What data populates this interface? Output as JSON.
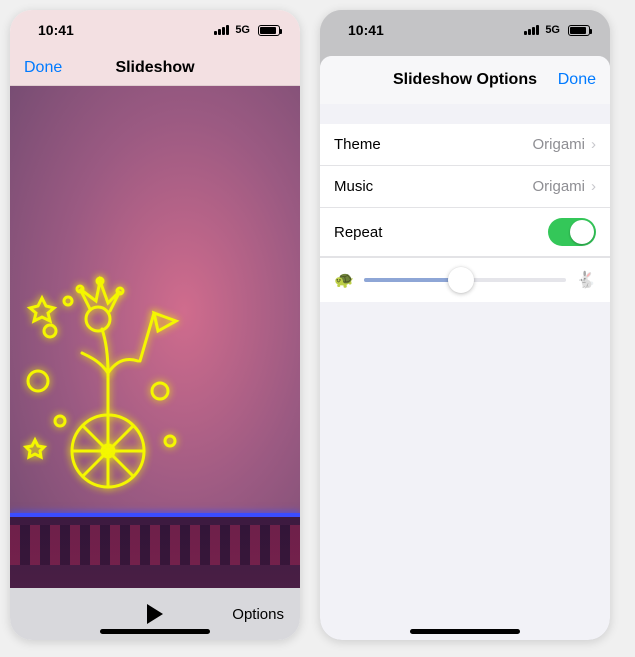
{
  "status": {
    "time": "10:41",
    "network": "5G"
  },
  "phone1": {
    "done": "Done",
    "title": "Slideshow",
    "options": "Options"
  },
  "phone2": {
    "sheet_title": "Slideshow Options",
    "done": "Done",
    "rows": {
      "theme": {
        "label": "Theme",
        "value": "Origami"
      },
      "music": {
        "label": "Music",
        "value": "Origami"
      },
      "repeat": {
        "label": "Repeat",
        "on": true
      }
    },
    "speed": {
      "slow_icon": "🐢",
      "fast_icon": "🐇",
      "value_pct": 48
    }
  }
}
